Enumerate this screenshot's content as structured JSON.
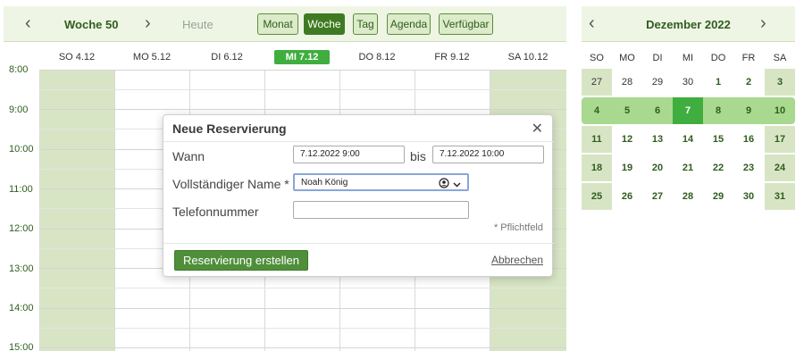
{
  "toolbar": {
    "week_label": "Woche 50",
    "today_label": "Heute",
    "views": [
      "Monat",
      "Woche",
      "Tag",
      "Agenda",
      "Verfügbar"
    ],
    "active_view": "Woche"
  },
  "week": {
    "days": [
      "SO 4.12",
      "MO 5.12",
      "DI 6.12",
      "MI 7.12",
      "DO 8.12",
      "FR 9.12",
      "SA 10.12"
    ],
    "today_index": 3,
    "times": [
      "8:00",
      "9:00",
      "10:00",
      "11:00",
      "12:00",
      "13:00",
      "14:00",
      "15:00"
    ]
  },
  "mini_calendar": {
    "title": "Dezember 2022",
    "weekdays": [
      "SO",
      "MO",
      "DI",
      "MI",
      "DO",
      "FR",
      "SA"
    ],
    "weeks": [
      [
        "27",
        "28",
        "29",
        "30",
        "1",
        "2",
        "3"
      ],
      [
        "4",
        "5",
        "6",
        "7",
        "8",
        "9",
        "10"
      ],
      [
        "11",
        "12",
        "13",
        "14",
        "15",
        "16",
        "17"
      ],
      [
        "18",
        "19",
        "20",
        "21",
        "22",
        "23",
        "24"
      ],
      [
        "25",
        "26",
        "27",
        "28",
        "29",
        "30",
        "31"
      ]
    ],
    "selected_week_index": 1,
    "selected_day": "7"
  },
  "modal": {
    "title": "Neue Reservierung",
    "close_icon": "close-icon",
    "when_label": "Wann",
    "from_value": "7.12.2022  9:00",
    "to_label": "bis",
    "to_value": "7.12.2022  10:00",
    "name_label": "Vollständiger Name *",
    "name_value": "Noah König",
    "name_icons": [
      "user-circle-icon",
      "chevron-down-icon"
    ],
    "phone_label": "Telefonnummer",
    "phone_value": "",
    "required_note": "* Pflichtfeld",
    "create_button": "Reservierung erstellen",
    "cancel_link": "Abbrechen"
  },
  "colors": {
    "accent": "#3f7a22",
    "today": "#3fae3f",
    "weekend": "#d8e5c5",
    "toolbar_bg": "#eef5e4"
  }
}
